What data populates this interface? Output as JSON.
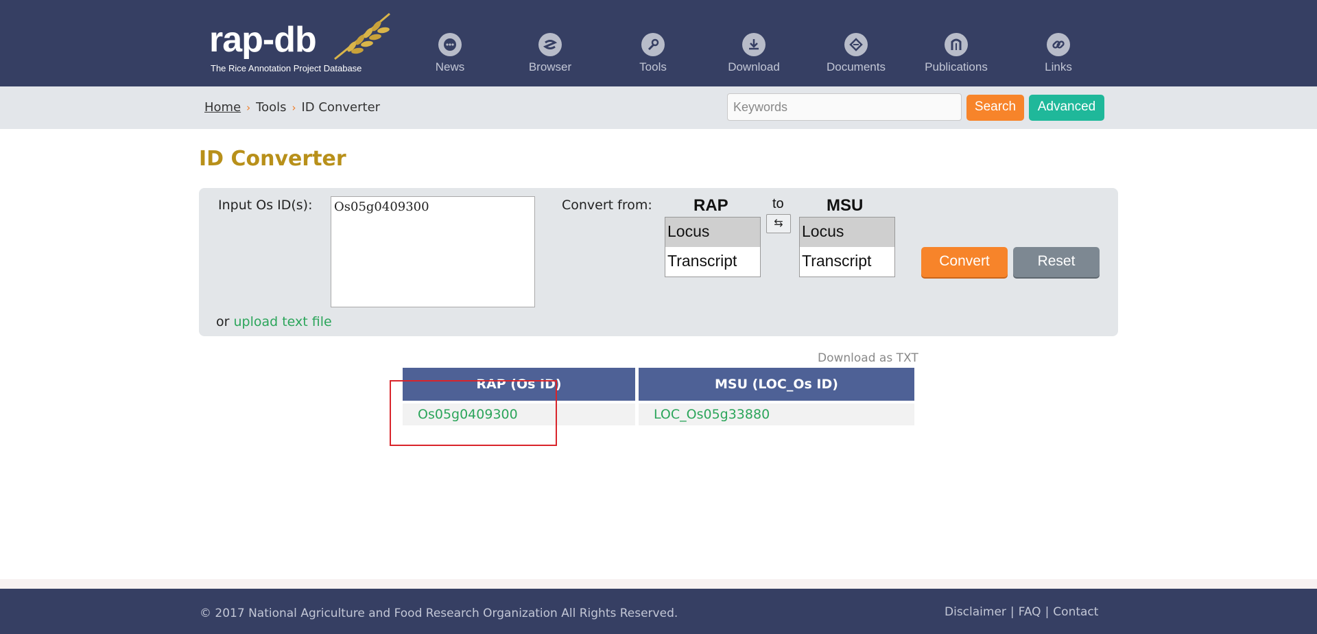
{
  "header": {
    "logo_text": "rap-db",
    "logo_subtitle": "The Rice Annotation Project Database",
    "nav": [
      {
        "label": "News",
        "icon": "chat-icon"
      },
      {
        "label": "Browser",
        "icon": "browser-icon"
      },
      {
        "label": "Tools",
        "icon": "wrench-icon"
      },
      {
        "label": "Download",
        "icon": "download-icon"
      },
      {
        "label": "Documents",
        "icon": "documents-icon"
      },
      {
        "label": "Publications",
        "icon": "publications-icon"
      },
      {
        "label": "Links",
        "icon": "link-icon"
      }
    ]
  },
  "breadcrumb": {
    "home": "Home",
    "tools": "Tools",
    "current": "ID Converter"
  },
  "search": {
    "placeholder": "Keywords",
    "value": "",
    "search_label": "Search",
    "advanced_label": "Advanced"
  },
  "main": {
    "title": "ID Converter",
    "input_label": "Input Os ID(s):",
    "input_value": "Os05g0409300",
    "or_text": "or",
    "upload_label": "upload text file",
    "convert_from_label": "Convert from:",
    "from_db": "RAP",
    "to_label": "to",
    "to_db": "MSU",
    "swap_symbol": "⇆",
    "from_options": [
      "Locus",
      "Transcript"
    ],
    "from_selected": "Locus",
    "to_options": [
      "Locus",
      "Transcript"
    ],
    "to_selected": "Locus",
    "convert_label": "Convert",
    "reset_label": "Reset",
    "download_label": "Download as TXT"
  },
  "results": {
    "columns": [
      "RAP (Os ID)",
      "MSU (LOC_Os ID)"
    ],
    "rows": [
      [
        "Os05g0409300",
        "LOC_Os05g33880"
      ]
    ]
  },
  "colors": {
    "header_bg": "#363f63",
    "accent_orange": "#f7842a",
    "accent_green": "#1fb89a",
    "title_gold": "#b8901a",
    "table_header": "#4e6196",
    "link_green": "#2ba55a",
    "highlight_red": "#d9242a"
  },
  "footer": {
    "copyright": "© 2017 National Agriculture and Food Research Organization All Rights Reserved.",
    "links": [
      "Disclaimer",
      "FAQ",
      "Contact"
    ],
    "separator": "|"
  }
}
